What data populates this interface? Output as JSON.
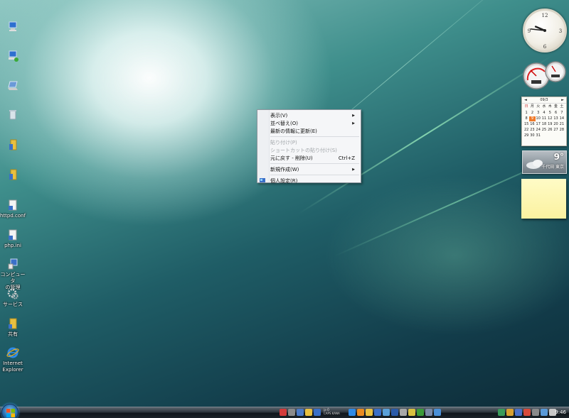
{
  "desktop": {
    "icons": [
      {
        "label": "",
        "icon": "network-computer-icon"
      },
      {
        "label": "",
        "icon": "network-icon"
      },
      {
        "label": "",
        "icon": "laptop-icon"
      },
      {
        "label": "",
        "icon": "recycle-bin-icon"
      },
      {
        "label": "",
        "icon": "folder-icon"
      },
      {
        "label": "",
        "icon": "folder-icon"
      },
      {
        "label": "httpd.conf",
        "icon": "text-file-icon"
      },
      {
        "label": "php.ini",
        "icon": "ini-file-icon"
      },
      {
        "label": "コンピュータ\nの管理",
        "icon": "computer-management-icon"
      },
      {
        "label": "サービス",
        "icon": "services-icon"
      },
      {
        "label": "共有",
        "icon": "shared-folder-icon"
      },
      {
        "label": "Internet\nExplorer",
        "icon": "internet-explorer-icon"
      }
    ]
  },
  "context_menu": {
    "items": [
      {
        "label": "表示(V)",
        "submenu": true,
        "disabled": false
      },
      {
        "label": "並べ替え(O)",
        "submenu": true,
        "disabled": false
      },
      {
        "label": "最新の情報に更新(E)",
        "submenu": false,
        "disabled": false
      },
      {
        "label": "貼り付け(P)",
        "submenu": false,
        "disabled": true
      },
      {
        "label": "ショートカットの貼り付け(S)",
        "submenu": false,
        "disabled": true
      },
      {
        "label": "元に戻す - 削除(U)",
        "shortcut": "Ctrl+Z",
        "submenu": false,
        "disabled": false
      },
      {
        "label": "新規作成(W)",
        "submenu": true,
        "disabled": false
      },
      {
        "label": "個人設定(R)",
        "submenu": false,
        "disabled": false
      }
    ],
    "arrow_glyph": "▶"
  },
  "gadgets": {
    "clock": {
      "hour": 9,
      "minute": 46
    },
    "calendar": {
      "header": "09/3",
      "weekdays": [
        "日",
        "月",
        "火",
        "水",
        "木",
        "金",
        "土"
      ],
      "days": [
        "1",
        "2",
        "3",
        "4",
        "5",
        "6",
        "7",
        "8",
        "9",
        "10",
        "11",
        "12",
        "13",
        "14",
        "15",
        "16",
        "17",
        "18",
        "19",
        "20",
        "21",
        "22",
        "23",
        "24",
        "25",
        "26",
        "27",
        "28",
        "29",
        "30",
        "31"
      ],
      "leading_blanks": 0,
      "today": "9",
      "prev": "◄",
      "next": "►"
    },
    "weather": {
      "temp": "9°",
      "city": "千代田 東京"
    }
  },
  "taskbar": {
    "time": "9:46",
    "deskband_line1": "ja·Ǒ",
    "deskband_line2": "CAPS KANA"
  },
  "colors": {
    "accent": "#2a6fb0",
    "today_highlight": "#f07a2a",
    "sticky_note": "#fbf2a0"
  }
}
